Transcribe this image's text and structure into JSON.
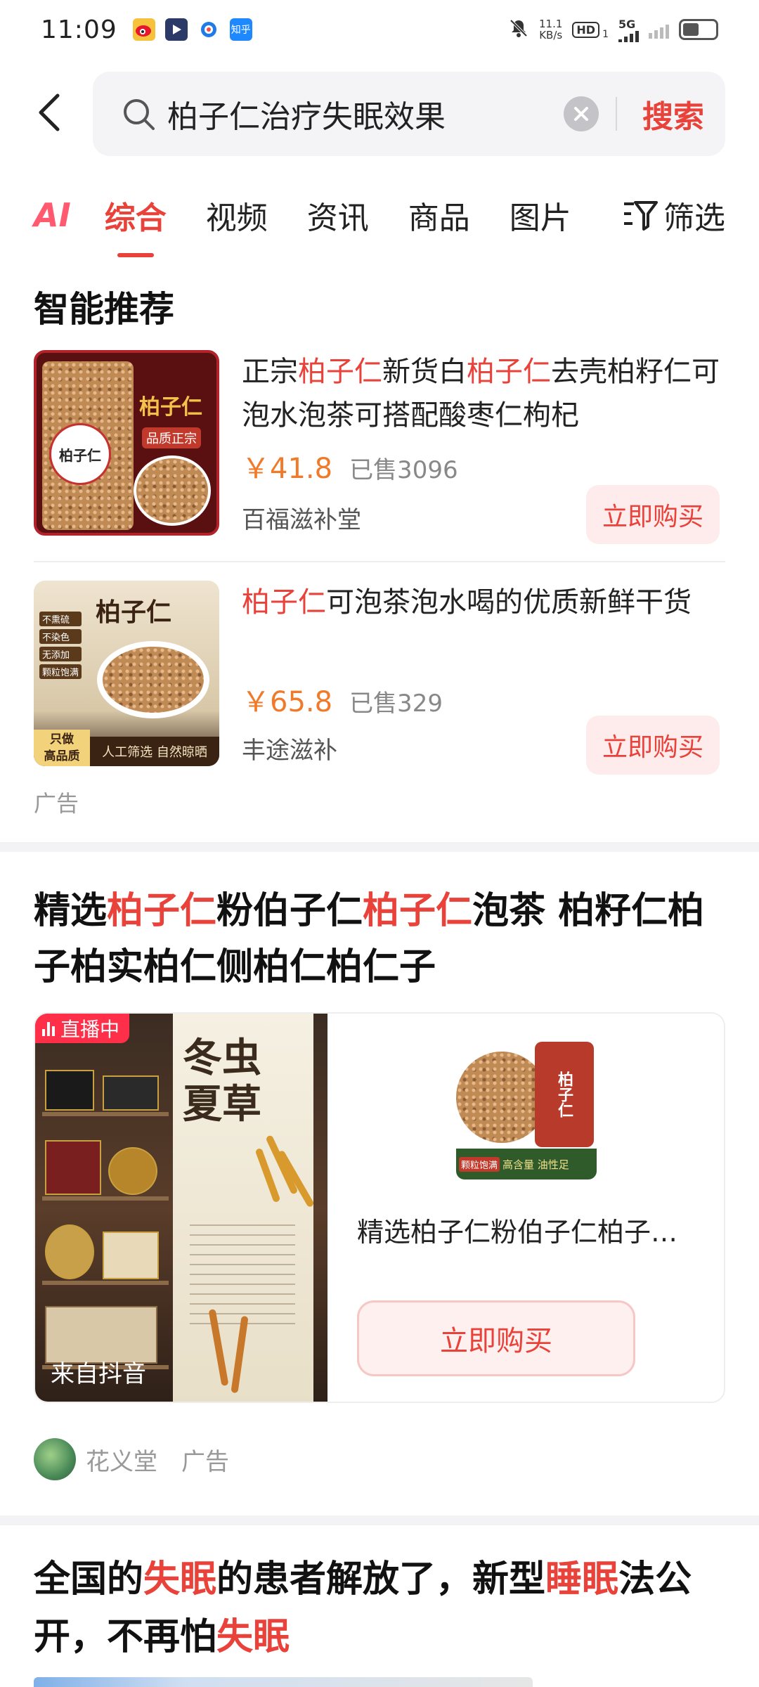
{
  "status_bar": {
    "time": "11:09",
    "apps": [
      "weibo-icon",
      "video-app-icon",
      "browser-icon",
      "zhihu-icon"
    ],
    "zhihu_label": "知乎",
    "speed_value": "11.1",
    "speed_unit": "KB/s",
    "hd_label": "HD",
    "hd_sub": "1",
    "network": "5G"
  },
  "search": {
    "query": "柏子仁治疗失眠效果",
    "button_label": "搜索"
  },
  "tabs": {
    "ai_label": "AI",
    "items": [
      "综合",
      "视频",
      "资讯",
      "商品",
      "图片"
    ],
    "active_index": 0,
    "filter_label": "筛选"
  },
  "recommend": {
    "title": "智能推荐",
    "products": [
      {
        "title_parts": [
          "正宗",
          "柏子仁",
          "新货白",
          "柏子仁",
          "去壳柏籽仁可泡水泡茶可搭配酸枣仁枸杞"
        ],
        "price": "￥41.8",
        "sold": "已售3096",
        "shop": "百福滋补堂",
        "buy_label": "立即购买",
        "img_label": "柏子仁",
        "img_tag": "品质正宗"
      },
      {
        "title_parts": [
          "柏子仁",
          "可泡茶泡水喝的优质新鲜干货"
        ],
        "price": "￥65.8",
        "sold": "已售329",
        "shop": "丰途滋补",
        "buy_label": "立即购买",
        "img_label": "柏子仁",
        "img_tags": [
          "不熏硫",
          "不染色",
          "无添加",
          "颗粒饱满"
        ],
        "img_footer_a": "只做\n高品质",
        "img_footer_b": "人工筛选 自然晾晒"
      }
    ],
    "ad_label": "广告"
  },
  "featured": {
    "title_parts": [
      "精选",
      "柏子仁",
      "粉伯子仁",
      "柏子仁",
      "泡茶 柏籽仁柏子柏实柏仁侧柏仁柏仁子"
    ],
    "live_label": "直播中",
    "from_label": "来自抖音",
    "poster_text": "冬虫夏草",
    "product_name": "精选柏子仁粉伯子仁柏子仁泡茶柏籽仁",
    "product_img_label": "柏子仁",
    "product_img_tags": [
      "颗粒饱满",
      "高含量 油性足"
    ],
    "buy_label": "立即购买",
    "shop": "花义堂",
    "ad_label": "广告"
  },
  "article": {
    "title_parts": [
      "全国的",
      "失眠",
      "的患者解放了，新型",
      "睡眠",
      "法公开，不再怕",
      "失眠"
    ]
  },
  "colors": {
    "accent": "#e8423a",
    "price": "#f07a2a",
    "muted": "#999999"
  }
}
